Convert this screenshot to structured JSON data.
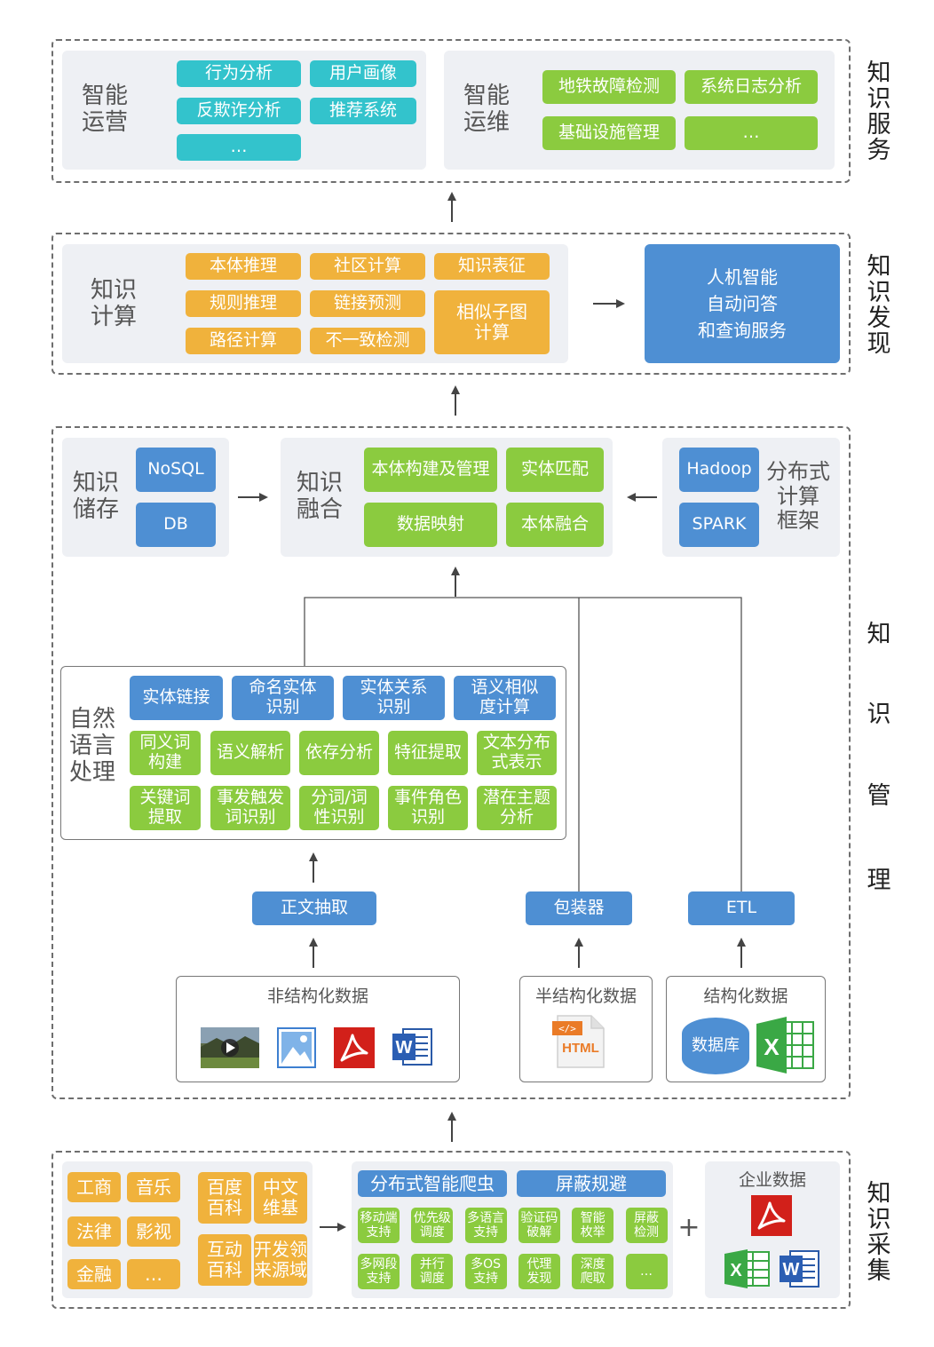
{
  "layers": {
    "service": "知\n识\n服\n务",
    "discovery": "知\n识\n发\n现",
    "management": [
      "知",
      "识",
      "管",
      "理"
    ],
    "collection": "知\n识\n采\n集"
  },
  "service": {
    "ops_label": "智能\n运营",
    "ops_items": [
      "行为分析",
      "用户画像",
      "反欺诈分析",
      "推荐系统",
      "…"
    ],
    "maint_label": "智能\n运维",
    "maint_items": [
      "地铁故障检测",
      "系统日志分析",
      "基础设施管理",
      "…"
    ]
  },
  "discovery": {
    "compute_label": "知识\n计算",
    "compute_items": [
      "本体推理",
      "社区计算",
      "知识表征",
      "规则推理",
      "链接预测",
      "相似子图\n计算",
      "路径计算",
      "不一致检测"
    ],
    "service_box": "人机智能\n自动问答\n和查询服务"
  },
  "management": {
    "storage_label": "知识\n储存",
    "storage_items": [
      "NoSQL",
      "DB"
    ],
    "fusion_label": "知识\n融合",
    "fusion_items": [
      "本体构建及管理",
      "实体匹配",
      "数据映射",
      "本体融合"
    ],
    "dist_items": [
      "Hadoop",
      "SPARK"
    ],
    "dist_label": "分布式\n计算\n框架",
    "nlp_label": "自然\n语言\n处理",
    "nlp_blue": [
      "实体链接",
      "命名实体\n识别",
      "实体关系\n识别",
      "语义相似\n度计算"
    ],
    "nlp_green": [
      "同义词\n构建",
      "语义解析",
      "依存分析",
      "特征提取",
      "文本分布\n式表示",
      "关键词\n提取",
      "事发触发\n词识别",
      "分词/词\n性识别",
      "事件角色\n识别",
      "潜在主题\n分析"
    ],
    "extract": [
      "正文抽取",
      "包装器",
      "ETL"
    ],
    "unstructured": "非结构化数据",
    "semi": "半结构化数据",
    "html_label": "HTML",
    "structured": "结构化数据",
    "db_label": "数据库"
  },
  "collection": {
    "sources_left": [
      "工商",
      "音乐",
      "法律",
      "影视",
      "金融",
      "…"
    ],
    "sources_right": [
      "百度\n百科",
      "中文\n维基",
      "互动\n百科",
      "开发领\n来源域"
    ],
    "crawler": "分布式智能爬虫",
    "shield": "屏蔽规避",
    "crawler_items": [
      "移动端\n支持",
      "优先级\n调度",
      "多语言\n支持",
      "验证码\n破解",
      "智能\n枚举",
      "屏蔽\n检测",
      "多网段\n支持",
      "并行\n调度",
      "多OS\n支持",
      "代理\n发现",
      "深度\n爬取",
      "…"
    ],
    "plus": "+",
    "enterprise": "企业数据"
  },
  "icons": [
    "video-icon",
    "image-icon",
    "pdf-icon",
    "word-icon",
    "html-icon",
    "database-icon",
    "excel-icon"
  ],
  "colors": {
    "teal": "#33c3cc",
    "green": "#8bcb3f",
    "orange": "#f0b23c",
    "blue": "#4e8fd3",
    "panel": "#eef0f4"
  }
}
